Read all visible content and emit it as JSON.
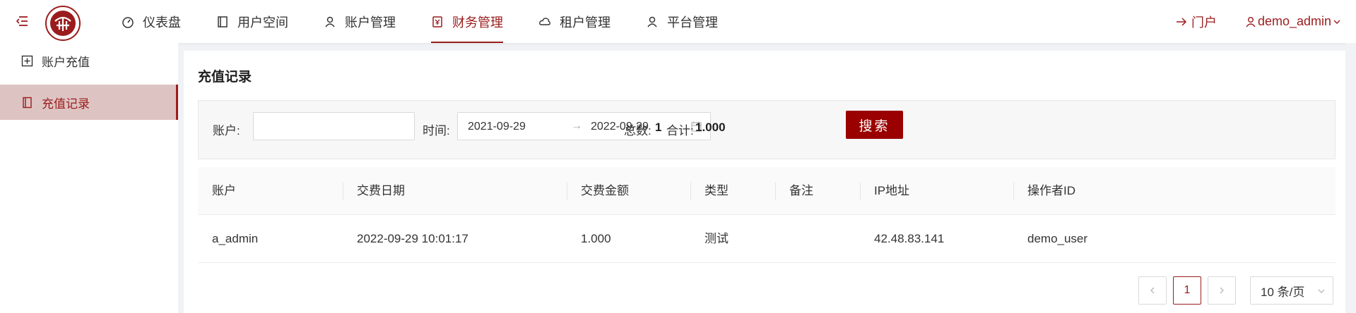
{
  "colors": {
    "accent": "#9b1c1c",
    "button": "#9b0000",
    "sidebar_active_bg": "#ddc4c3"
  },
  "nav": {
    "items": [
      {
        "label": "仪表盘",
        "icon": "dashboard-icon"
      },
      {
        "label": "用户空间",
        "icon": "book-icon"
      },
      {
        "label": "账户管理",
        "icon": "user-icon"
      },
      {
        "label": "财务管理",
        "icon": "finance-icon",
        "active": true
      },
      {
        "label": "租户管理",
        "icon": "cloud-icon"
      },
      {
        "label": "平台管理",
        "icon": "user-icon"
      }
    ],
    "portal_label": "门户",
    "user_label": "demo_admin"
  },
  "sidebar": {
    "items": [
      {
        "label": "账户充值",
        "icon": "plus-square-icon"
      },
      {
        "label": "充值记录",
        "icon": "book-icon",
        "active": true
      }
    ]
  },
  "page": {
    "title": "充值记录",
    "filter": {
      "account_label": "账户:",
      "account_value": "",
      "time_label": "时间:",
      "start_date": "2021-09-29",
      "end_date": "2022-09-29",
      "range_arrow": "→",
      "total_label": "总数:",
      "total_value": "1",
      "sum_label": "合计:",
      "sum_value": "1.000",
      "search_label": "搜索"
    },
    "table": {
      "columns": [
        "账户",
        "交费日期",
        "交费金额",
        "类型",
        "备注",
        "IP地址",
        "操作者ID"
      ],
      "rows": [
        [
          "a_admin",
          "2022-09-29 10:01:17",
          "1.000",
          "测试",
          "",
          "42.48.83.141",
          "demo_user"
        ]
      ]
    },
    "pagination": {
      "current_page": "1",
      "page_size_label": "10 条/页"
    }
  }
}
